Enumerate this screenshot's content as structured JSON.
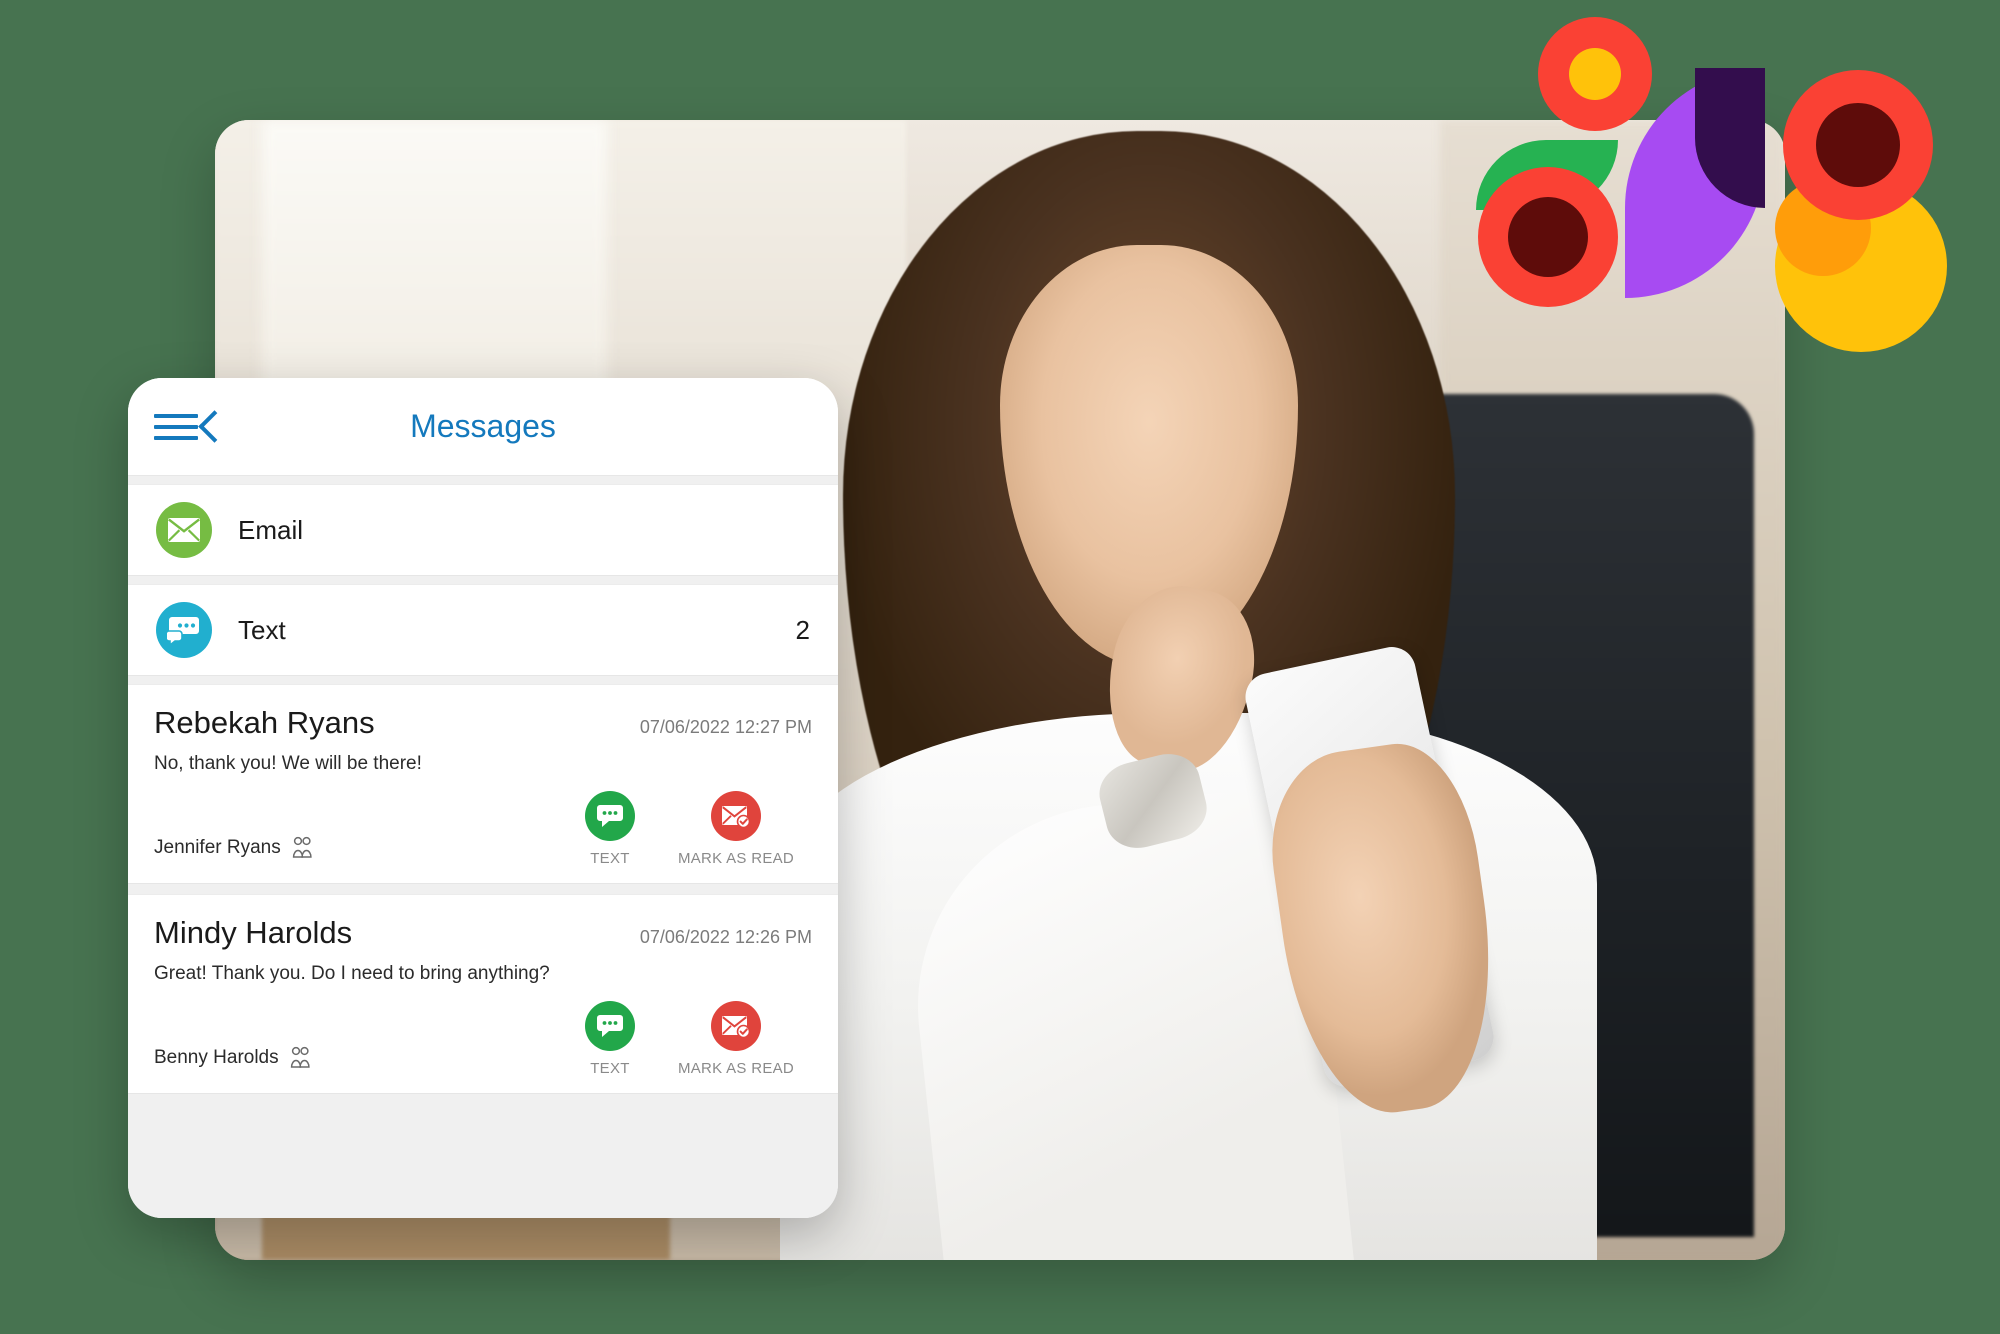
{
  "background": {
    "color": "#477350"
  },
  "hero": {
    "alt": "woman in white blouse smiling at smartphone in office"
  },
  "decorations": {
    "colors": {
      "red": "#fa4134",
      "yellow": "#ffc20a",
      "dark_red": "#5e0c0a",
      "green": "#26b252",
      "purple": "#a74bf2",
      "dark_purple": "#330d4d",
      "orange": "#ff9d0a"
    },
    "shapes": [
      {
        "name": "donut-red-yellow"
      },
      {
        "name": "donut-red-dark-top-right"
      },
      {
        "name": "leaf-green"
      },
      {
        "name": "donut-red-dark-bottom-left"
      },
      {
        "name": "leaf-purple"
      },
      {
        "name": "leaf-purple-dark"
      },
      {
        "name": "circle-yellow"
      },
      {
        "name": "circle-orange"
      }
    ]
  },
  "app": {
    "header": {
      "title": "Messages",
      "title_color": "#1479bd",
      "menu_icon": "hamburger-icon",
      "back_icon": "back-chevron-icon"
    },
    "channels": [
      {
        "label": "Email",
        "count": "",
        "icon": "envelope-icon",
        "color": "#76bc43"
      },
      {
        "label": "Text",
        "count": "2",
        "icon": "chat-bubble-icon",
        "color": "#21afcf"
      }
    ],
    "messages": [
      {
        "sender": "Rebekah Ryans",
        "timestamp": "07/06/2022 12:27 PM",
        "preview": "No, thank you! We will be there!",
        "contact": "Jennifer Ryans",
        "contact_icon": "people-icon",
        "actions": [
          {
            "label": "TEXT",
            "icon": "chat-bubble-icon",
            "color": "#22a74a"
          },
          {
            "label": "MARK AS READ",
            "icon": "envelope-check-icon",
            "color": "#e0443c"
          }
        ]
      },
      {
        "sender": "Mindy Harolds",
        "timestamp": "07/06/2022 12:26 PM",
        "preview": "Great! Thank you. Do I need to bring anything?",
        "contact": "Benny Harolds",
        "contact_icon": "people-icon",
        "actions": [
          {
            "label": "TEXT",
            "icon": "chat-bubble-icon",
            "color": "#22a74a"
          },
          {
            "label": "MARK AS READ",
            "icon": "envelope-check-icon",
            "color": "#e0443c"
          }
        ]
      }
    ]
  }
}
